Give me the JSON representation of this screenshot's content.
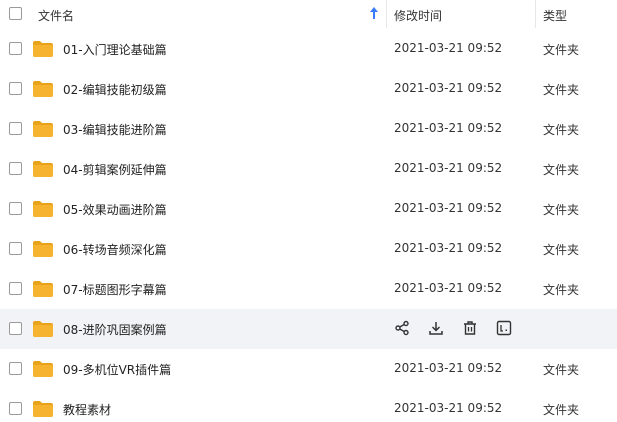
{
  "header": {
    "name_label": "文件名",
    "time_label": "修改时间",
    "type_label": "类型",
    "sort_icon": "sort-ascending-arrow-icon"
  },
  "rows": [
    {
      "name": "01-入门理论基础篇",
      "time": "2021-03-21 09:52",
      "type": "文件夹"
    },
    {
      "name": "02-编辑技能初级篇",
      "time": "2021-03-21 09:52",
      "type": "文件夹"
    },
    {
      "name": "03-编辑技能进阶篇",
      "time": "2021-03-21 09:52",
      "type": "文件夹"
    },
    {
      "name": "04-剪辑案例延伸篇",
      "time": "2021-03-21 09:52",
      "type": "文件夹"
    },
    {
      "name": "05-效果动画进阶篇",
      "time": "2021-03-21 09:52",
      "type": "文件夹"
    },
    {
      "name": "06-转场音频深化篇",
      "time": "2021-03-21 09:52",
      "type": "文件夹"
    },
    {
      "name": "07-标题图形字幕篇",
      "time": "2021-03-21 09:52",
      "type": "文件夹"
    },
    {
      "name": "08-进阶巩固案例篇",
      "time": "",
      "type": "",
      "hover": true
    },
    {
      "name": "09-多机位VR插件篇",
      "time": "2021-03-21 09:52",
      "type": "文件夹"
    },
    {
      "name": "教程素材",
      "time": "2021-03-21 09:52",
      "type": "文件夹"
    }
  ],
  "row_actions": [
    "share-icon",
    "download-icon",
    "delete-icon",
    "more-icon"
  ],
  "colors": {
    "folder": "#f5b330",
    "folder_back": "#e9a21b",
    "hover_bg": "#f2f3f6",
    "sort_arrow": "#3b7cff"
  }
}
